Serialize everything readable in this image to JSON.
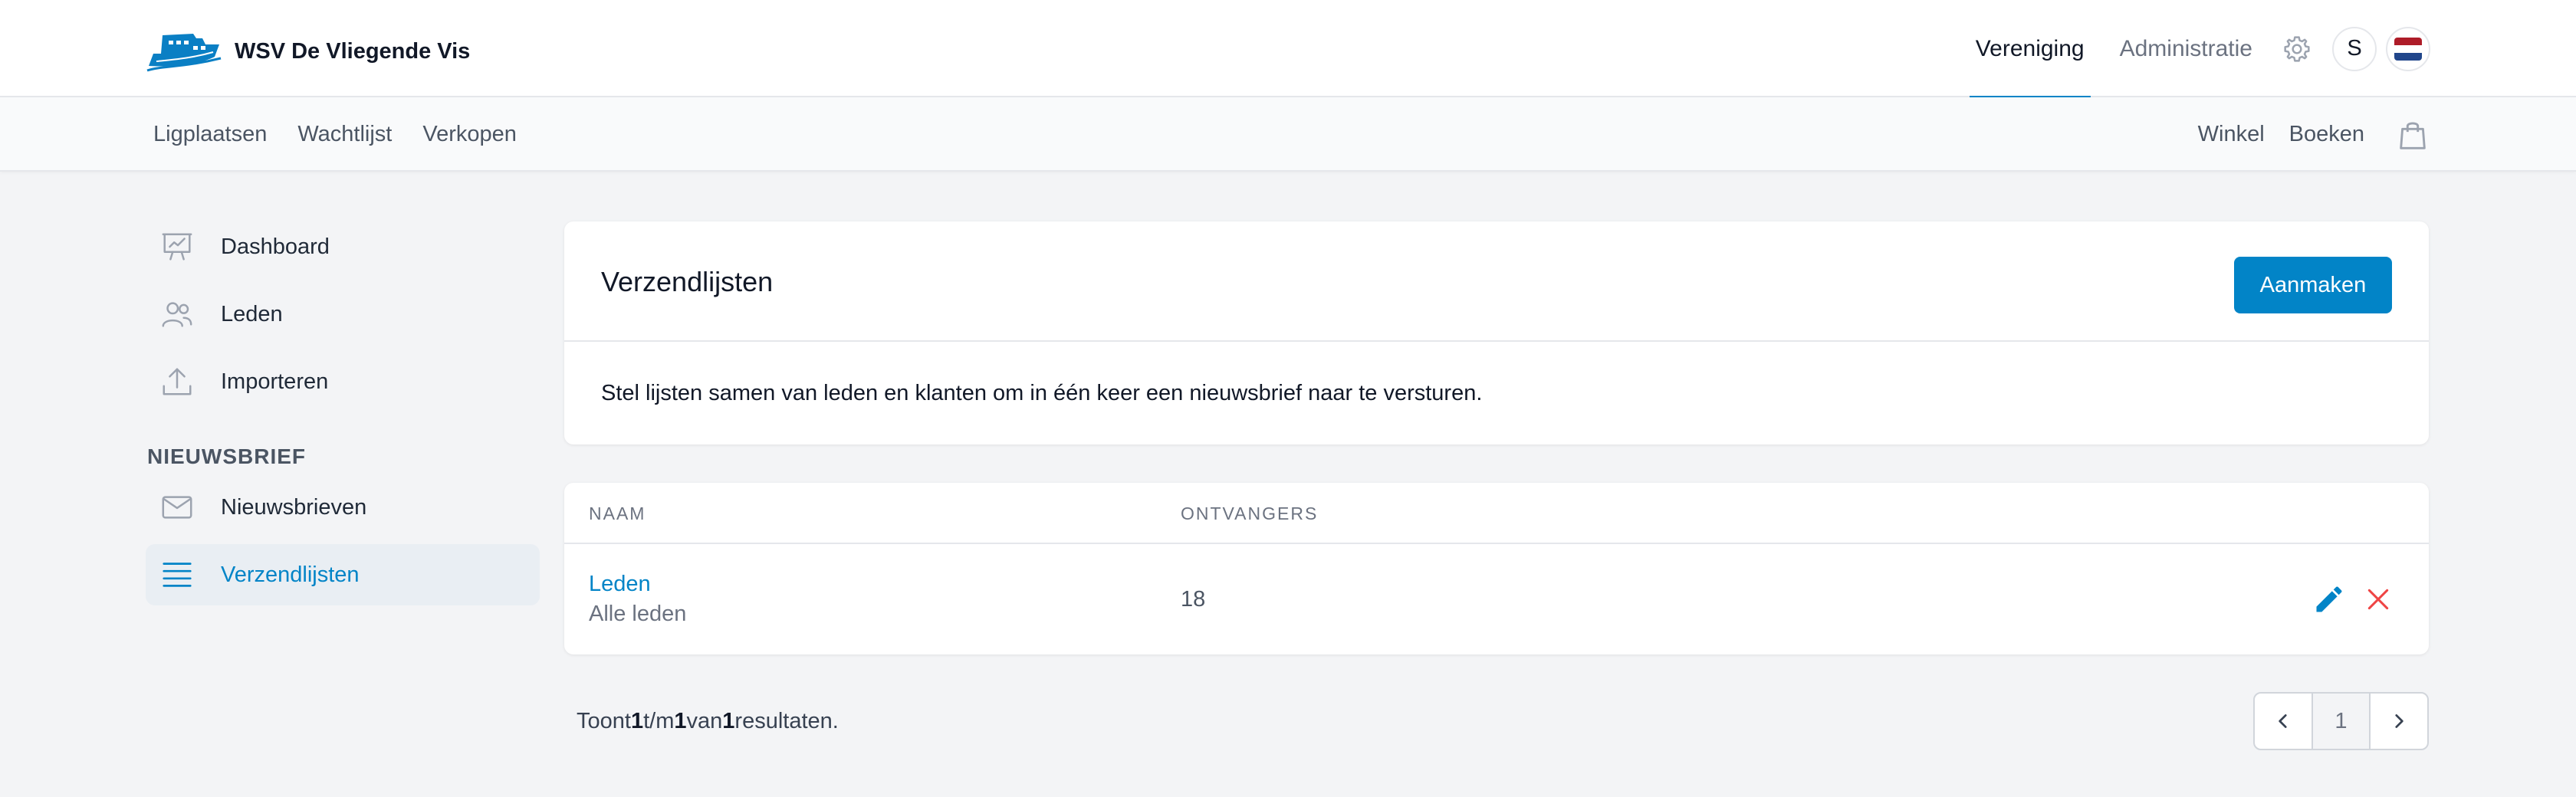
{
  "header": {
    "logo_icon": "boat-logo-icon",
    "brand_name": "WSV De Vliegende Vis",
    "nav": [
      {
        "label": "Vereniging",
        "active": true
      },
      {
        "label": "Administratie",
        "active": false
      }
    ],
    "settings_icon": "gear-icon",
    "avatar_initial": "S",
    "language_icon": "dutch-flag-icon"
  },
  "subnav": {
    "left": [
      "Ligplaatsen",
      "Wachtlijst",
      "Verkopen"
    ],
    "right": [
      "Winkel",
      "Boeken"
    ],
    "cart_icon": "shopping-bag-icon"
  },
  "sidebar": {
    "items": [
      {
        "label": "Dashboard",
        "icon": "presentation-chart-icon"
      },
      {
        "label": "Leden",
        "icon": "users-icon"
      },
      {
        "label": "Importeren",
        "icon": "upload-icon"
      }
    ],
    "section_heading": "NIEUWSBRIEF",
    "section_items": [
      {
        "label": "Nieuwsbrieven",
        "icon": "envelope-icon",
        "active": false
      },
      {
        "label": "Verzendlijsten",
        "icon": "list-icon",
        "active": true
      }
    ]
  },
  "main": {
    "title": "Verzendlijsten",
    "create_button": "Aanmaken",
    "description": "Stel lijsten samen van leden en klanten om in één keer een nieuwsbrief naar te versturen.",
    "table": {
      "columns": [
        "NAAM",
        "ONTVANGERS"
      ],
      "rows": [
        {
          "name": "Leden",
          "subtitle": "Alle leden",
          "recipients": "18",
          "edit_icon": "pencil-icon",
          "delete_icon": "close-icon"
        }
      ]
    },
    "results": {
      "prefix": "Toont",
      "from": "1",
      "sep1": "t/m",
      "to": "1",
      "sep2": "van",
      "total": "1",
      "suffix": "resultaten."
    },
    "pagination": {
      "current": "1"
    }
  },
  "colors": {
    "accent": "#0284c7",
    "danger": "#ef4444",
    "background": "#f3f4f6",
    "flag_red": "#ae1c28",
    "flag_white": "#ffffff",
    "flag_blue": "#21468b"
  }
}
